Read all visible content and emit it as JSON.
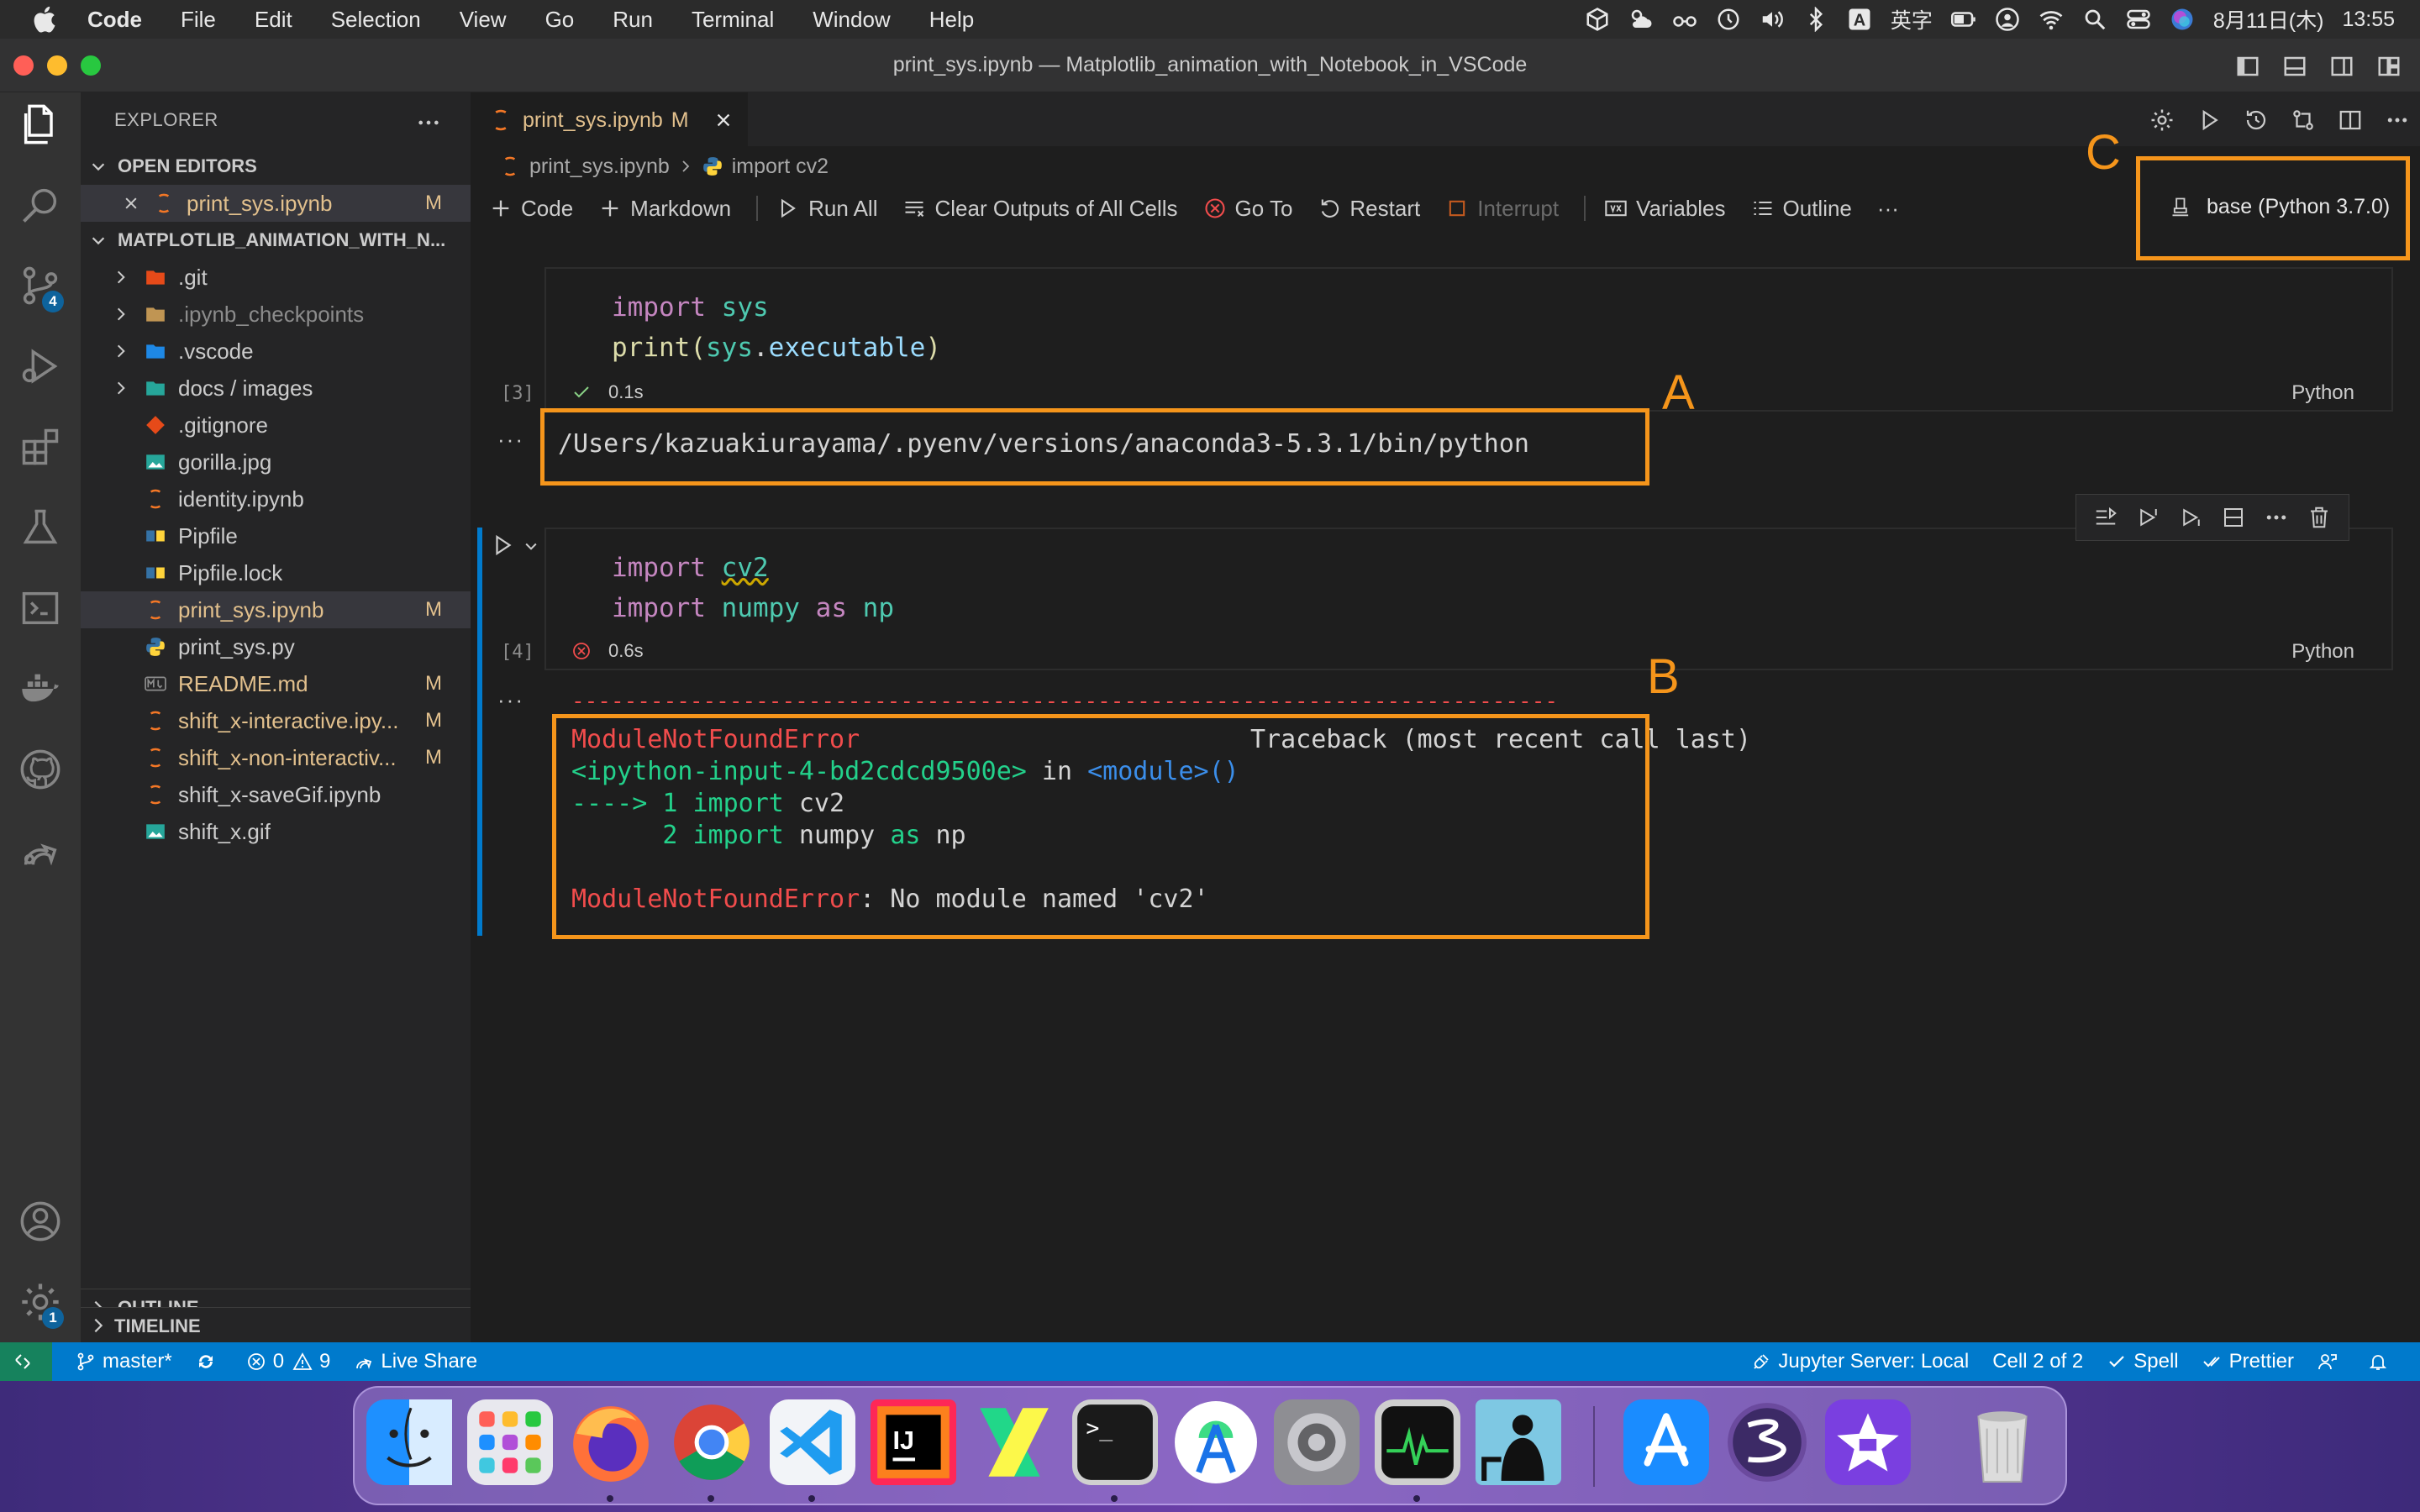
{
  "menubar": {
    "app": "Code",
    "items": [
      "File",
      "Edit",
      "Selection",
      "View",
      "Go",
      "Run",
      "Terminal",
      "Window",
      "Help"
    ],
    "ime": "英字",
    "date": "8月11日(木)",
    "time": "13:55"
  },
  "window": {
    "title": "print_sys.ipynb — Matplotlib_animation_with_Notebook_in_VSCode"
  },
  "activity": {
    "scm_badge": "4",
    "settings_badge": "1"
  },
  "sidebar": {
    "title": "EXPLORER",
    "open_editors_label": "OPEN EDITORS",
    "open_editor": {
      "name": "print_sys.ipynb",
      "status": "M"
    },
    "project_label": "MATPLOTLIB_ANIMATION_WITH_N...",
    "files": [
      {
        "name": ".git",
        "status": ""
      },
      {
        "name": ".ipynb_checkpoints",
        "status": ""
      },
      {
        "name": ".vscode",
        "status": ""
      },
      {
        "name": "docs / images",
        "status": ""
      },
      {
        "name": ".gitignore",
        "status": ""
      },
      {
        "name": "gorilla.jpg",
        "status": ""
      },
      {
        "name": "identity.ipynb",
        "status": ""
      },
      {
        "name": "Pipfile",
        "status": ""
      },
      {
        "name": "Pipfile.lock",
        "status": ""
      },
      {
        "name": "print_sys.ipynb",
        "status": "M"
      },
      {
        "name": "print_sys.py",
        "status": ""
      },
      {
        "name": "README.md",
        "status": "M"
      },
      {
        "name": "shift_x-interactive.ipy...",
        "status": "M"
      },
      {
        "name": "shift_x-non-interactiv...",
        "status": "M"
      },
      {
        "name": "shift_x-saveGif.ipynb",
        "status": ""
      },
      {
        "name": "shift_x.gif",
        "status": ""
      }
    ],
    "outline_label": "OUTLINE",
    "timeline_label": "TIMELINE"
  },
  "tab": {
    "name": "print_sys.ipynb",
    "status": "M"
  },
  "breadcrumb": {
    "file": "print_sys.ipynb",
    "symbol": "import cv2"
  },
  "toolbar": {
    "code": "Code",
    "markdown": "Markdown",
    "run_all": "Run All",
    "clear": "Clear Outputs of All Cells",
    "goto": "Go To",
    "restart": "Restart",
    "interrupt": "Interrupt",
    "variables": "Variables",
    "outline": "Outline",
    "more": "···"
  },
  "kernel": "base (Python 3.7.0)",
  "cell1": {
    "exec": "[3]",
    "time": "0.1s",
    "lang": "Python",
    "line1": {
      "kw": "import",
      "mod": "sys"
    },
    "line2": {
      "fn": "print",
      "open": "(",
      "obj": "sys",
      "dot": ".",
      "attr": "executable",
      "close": ")"
    },
    "output": "/Users/kazuakiurayama/.pyenv/versions/anaconda3-5.3.1/bin/python"
  },
  "cell2": {
    "exec": "[4]",
    "time": "0.6s",
    "lang": "Python",
    "line1": {
      "kw": "import",
      "mod": "cv2"
    },
    "line2": {
      "kw": "import",
      "mod": "numpy",
      "as": "as",
      "alias": "np"
    },
    "error": {
      "rule": "---------------------------------------------------------------------------",
      "name": "ModuleNotFoundError",
      "traceback": "Traceback (most recent call last)",
      "input": "<ipython-input-4-bd2cdcd9500e>",
      "in": " in ",
      "module": "<module>",
      "parens": "()",
      "arrow": "----> 1 ",
      "l1_kw": "import",
      "l1_rest": " cv2",
      "l2_num": "      2 ",
      "l2_kw": "import",
      "l2_rest": " numpy ",
      "l2_as": "as",
      "l2_alias": " np",
      "final_name": "ModuleNotFoundError",
      "final_msg": ": No module named 'cv2'"
    }
  },
  "out_dots": "···",
  "annotations": {
    "a": "A",
    "b": "B",
    "c": "C"
  },
  "status": {
    "branch": "master*",
    "errors": "0",
    "warnings": "9",
    "live_share": "Live Share",
    "jupyter": "Jupyter Server: Local",
    "cell": "Cell 2 of 2",
    "spell": "Spell",
    "prettier": "Prettier"
  },
  "colors": {
    "accent": "#007acc",
    "annotation": "#f5951b",
    "modified": "#e2c08d",
    "error": "#f14c4c"
  }
}
